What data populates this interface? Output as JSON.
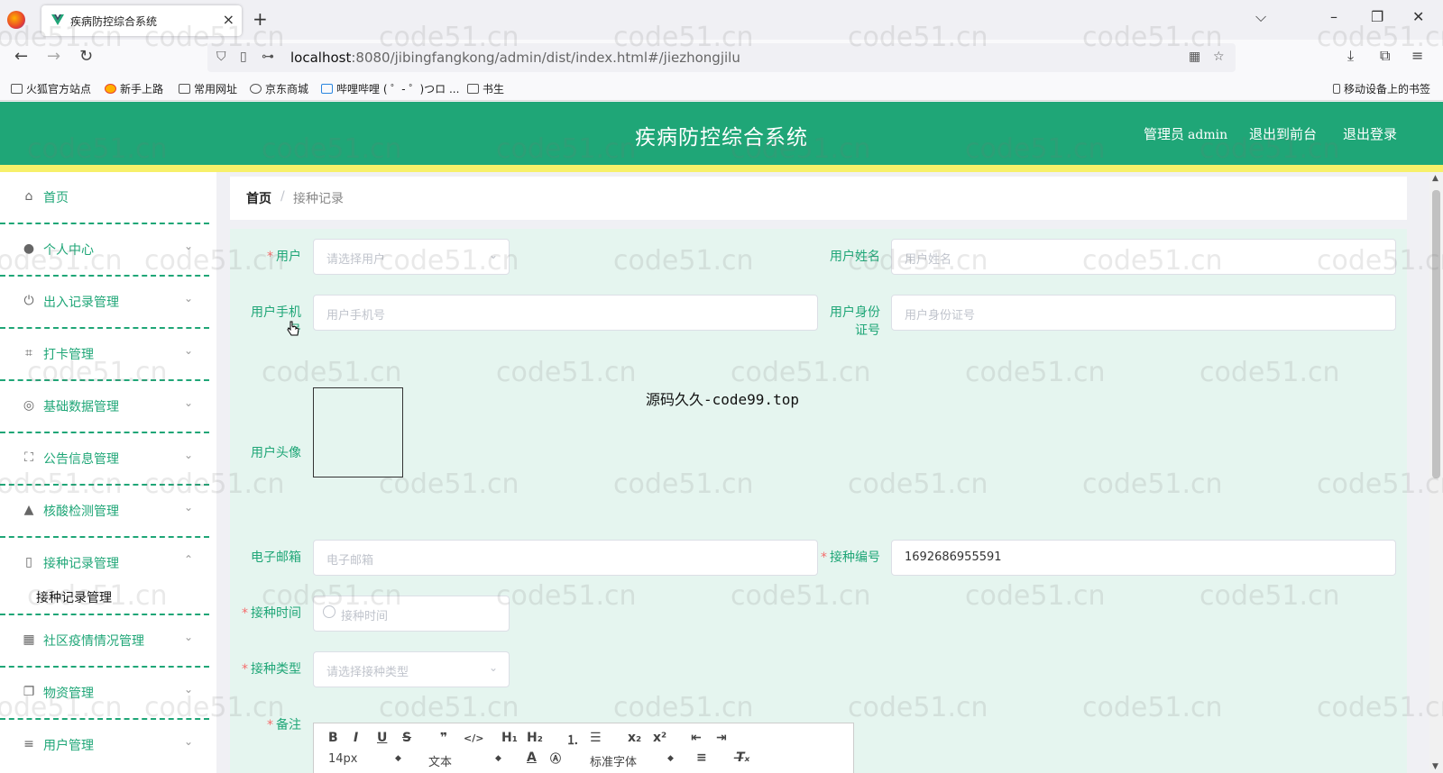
{
  "browser": {
    "tab_title": "疾病防控综合系统",
    "url_host": "localhost",
    "url_rest": ":8080/jibingfangkong/admin/dist/index.html#/jiezhongjilu",
    "bookmarks": [
      "火狐官方站点",
      "新手上路",
      "常用网址",
      "京东商城",
      "哔哩哔哩 ( ゜- ゜)つロ ...",
      "书生"
    ],
    "mobile_bookmarks": "移动设备上的书签"
  },
  "header": {
    "title": "疾病防控综合系统",
    "admin_label": "管理员",
    "admin_name": "admin",
    "front_link": "退出到前台",
    "logout_link": "退出登录"
  },
  "sidebar": {
    "items": [
      {
        "label": "首页",
        "icon": "home-icon"
      },
      {
        "label": "个人中心",
        "icon": "user-icon"
      },
      {
        "label": "出入记录管理",
        "icon": "power-icon"
      },
      {
        "label": "打卡管理",
        "icon": "crop-icon"
      },
      {
        "label": "基础数据管理",
        "icon": "globe-icon"
      },
      {
        "label": "公告信息管理",
        "icon": "fullscreen-icon"
      },
      {
        "label": "核酸检测管理",
        "icon": "person-icon"
      },
      {
        "label": "接种记录管理",
        "icon": "phone-icon"
      },
      {
        "label": "社区疫情情况管理",
        "icon": "grid-icon"
      },
      {
        "label": "物资管理",
        "icon": "copy-icon"
      },
      {
        "label": "用户管理",
        "icon": "list-icon"
      }
    ],
    "submenu_label": "接种记录管理"
  },
  "breadcrumb": {
    "home": "首页",
    "separator": "/",
    "current": "接种记录"
  },
  "form": {
    "user_label": "用户",
    "user_placeholder": "请选择用户",
    "username_label": "用户姓名",
    "username_placeholder": "用户姓名",
    "phone_label": "用户手机号",
    "phone_placeholder": "用户手机号",
    "idcard_label": "用户身份证号",
    "idcard_placeholder": "用户身份证号",
    "avatar_label": "用户头像",
    "email_label": "电子邮箱",
    "email_placeholder": "电子邮箱",
    "code_label": "接种编号",
    "code_value": "1692686955591",
    "time_label": "接种时间",
    "time_placeholder": "接种时间",
    "type_label": "接种类型",
    "type_placeholder": "请选择接种类型",
    "remark_label": "备注"
  },
  "editor": {
    "font_size": "14px",
    "block_type": "文本",
    "font_family": "标准字体"
  },
  "center_note": "源码久久-code99.top",
  "watermark": "code51.cn",
  "colors": {
    "primary": "#1fa677",
    "stripe": "#f7f06a",
    "panel": "#e5f5ef",
    "required": "#f56c6c"
  }
}
